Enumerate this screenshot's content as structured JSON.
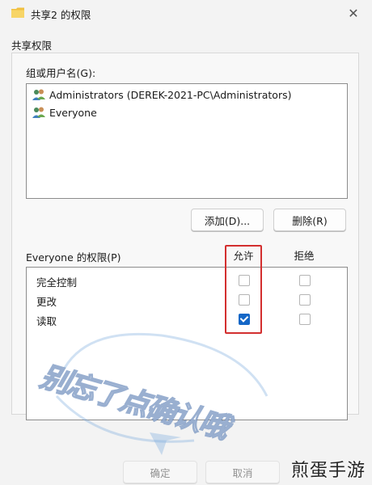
{
  "window": {
    "title": "共享2 的权限",
    "close_glyph": "✕"
  },
  "tab_label": "共享权限",
  "groups": {
    "label": "组或用户名(G):",
    "items": [
      {
        "name": "Administrators (DEREK-2021-PC\\Administrators)",
        "icon": "users-icon"
      },
      {
        "name": "Everyone",
        "icon": "users-icon"
      }
    ]
  },
  "buttons": {
    "add": "添加(D)...",
    "remove": "删除(R)",
    "ok": "确定",
    "cancel": "取消"
  },
  "permissions": {
    "label": "Everyone 的权限(P)",
    "allow_header": "允许",
    "deny_header": "拒绝",
    "rows": [
      {
        "name": "完全控制",
        "allow": false,
        "deny": false
      },
      {
        "name": "更改",
        "allow": false,
        "deny": false
      },
      {
        "name": "读取",
        "allow": true,
        "deny": false
      }
    ]
  },
  "overlay": {
    "watermark_text": "别忘了点确认哦",
    "corner_text": "煎蛋手游"
  },
  "colors": {
    "accent": "#1467c7",
    "highlight": "#d32f2f"
  }
}
